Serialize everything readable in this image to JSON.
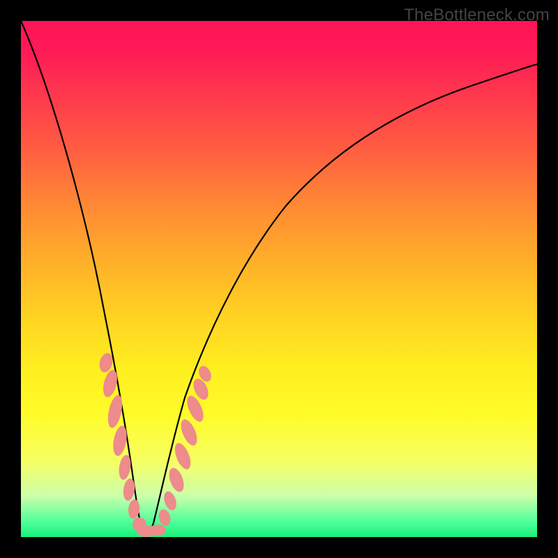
{
  "attribution": "TheBottleneck.com",
  "colors": {
    "frame": "#000000",
    "curve": "#000000",
    "marker_fill": "#ee8b8b",
    "marker_stroke": "#ee8b8b",
    "gradient_stops": [
      "#ff1458",
      "#ff1a55",
      "#ff3050",
      "#ff5a42",
      "#ff8a34",
      "#ffb428",
      "#ffd522",
      "#fff020",
      "#fffb28",
      "#f7ff60",
      "#ccffaa",
      "#50ff9a",
      "#18f07a"
    ]
  },
  "chart_data": {
    "type": "line",
    "title": "",
    "xlabel": "",
    "ylabel": "",
    "xlim": [
      0,
      100
    ],
    "ylim": [
      0,
      100
    ],
    "x": [
      0,
      2,
      4,
      6,
      8,
      10,
      12,
      14,
      16,
      18,
      19,
      20,
      21,
      22,
      23,
      24,
      25,
      26,
      28,
      30,
      32,
      34,
      36,
      40,
      45,
      50,
      55,
      60,
      65,
      70,
      75,
      80,
      85,
      90,
      95,
      100
    ],
    "values": [
      100,
      92,
      84,
      76,
      68,
      60,
      52,
      44,
      36,
      28,
      24,
      18,
      10,
      3,
      0,
      0,
      2,
      6,
      12,
      18,
      24,
      29,
      34,
      42,
      50,
      56,
      61,
      65,
      68,
      71,
      73.5,
      75.5,
      77,
      78.2,
      79.2,
      80
    ],
    "markers": {
      "description": "Salmon-colored marker cluster near the curve minimum",
      "x": [
        16.3,
        15.6,
        16.7,
        17.5,
        17.9,
        18.8,
        19.5,
        20.2,
        21.0,
        21.9,
        22.8,
        23.8,
        25.2,
        26.3,
        26.9,
        27.9,
        28.8,
        25.7,
        24.4
      ],
      "y": [
        35,
        32,
        29,
        25,
        21,
        16,
        11,
        7,
        3,
        1,
        0.5,
        1,
        5,
        10,
        14,
        19,
        24,
        30,
        34
      ]
    }
  }
}
